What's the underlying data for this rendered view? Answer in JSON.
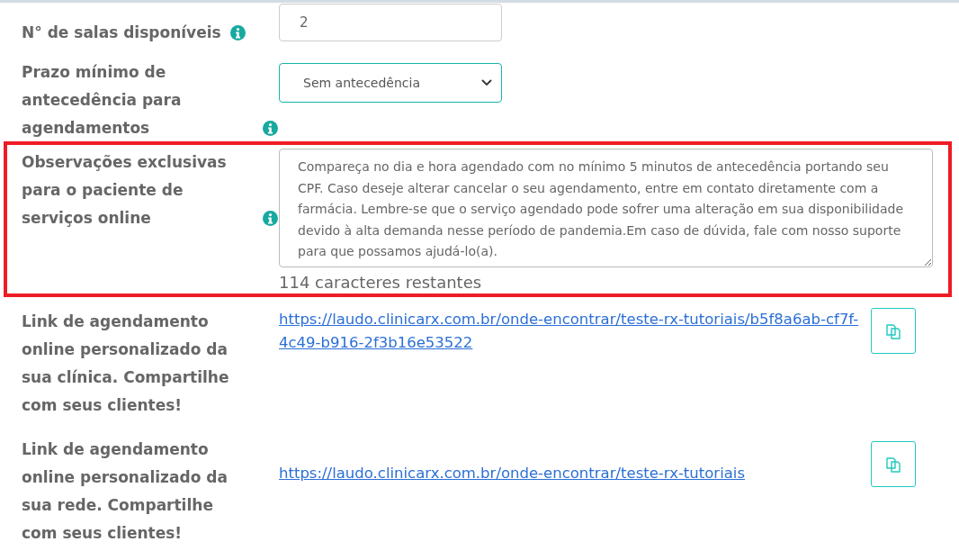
{
  "fields": [
    {
      "kind": "input",
      "label": "N° de salas disponíveis",
      "info": true,
      "value": "2",
      "highlighted": false
    },
    {
      "kind": "select",
      "label": "Prazo mínimo de antecedência para agendamentos",
      "info": true,
      "value": "Sem antecedência",
      "highlighted": false
    },
    {
      "kind": "textarea",
      "label": "Observações exclusivas para o paciente de serviços online",
      "info": true,
      "value": "Compareça no dia e hora agendado com no mínimo 5 minutos de antecedência portando seu CPF. Caso deseje alterar cancelar o seu agendamento, entre em contato diretamente com a farmácia. Lembre-se que o serviço agendado pode sofrer uma alteração em sua disponibilidade devido à alta demanda nesse período de pandemia.Em caso de dúvida, fale com nosso suporte para que possamos ajudá-lo(a).",
      "counter": "114 caracteres restantes",
      "highlighted": true
    },
    {
      "kind": "link",
      "label": "Link de agendamento online personalizado da sua clínica. Compartilhe com seus clientes!",
      "info": false,
      "value": "https://laudo.clinicarx.com.br/onde-encontrar/teste-rx-tutoriais/b5f8a6ab-cf7f-4c49-b916-2f3b16e53522",
      "highlighted": false
    },
    {
      "kind": "link",
      "label": "Link de agendamento online personalizado da sua rede. Compartilhe com seus clientes!",
      "info": false,
      "value": "https://laudo.clinicarx.com.br/onde-encontrar/teste-rx-tutoriais",
      "highlighted": false
    }
  ]
}
